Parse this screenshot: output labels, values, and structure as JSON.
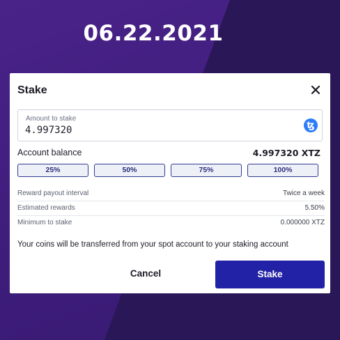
{
  "overlay": {
    "date": "06.22.2021"
  },
  "modal": {
    "title": "Stake",
    "close_icon": "close-icon",
    "amount": {
      "label": "Amount to stake",
      "value": "4.997320",
      "coin_icon": "tezos-icon",
      "coin_glyph": "ꜩ"
    },
    "balance": {
      "label": "Account balance",
      "value": "4.997320  XTZ"
    },
    "percent_buttons": [
      "25%",
      "50%",
      "75%",
      "100%"
    ],
    "info": [
      {
        "label": "Reward payout interval",
        "value": "Twice a week"
      },
      {
        "label": "Estimated rewards",
        "value": "5.50%"
      },
      {
        "label": "Minimum to stake",
        "value": "0.000000 XTZ"
      }
    ],
    "note": "Your coins will be transferred from your spot account to your staking account",
    "cancel_label": "Cancel",
    "stake_label": "Stake"
  },
  "colors": {
    "background_light": "#3d1c7a",
    "background_dark": "#2a1757",
    "primary_button": "#2222a6",
    "coin_icon": "#2c7df7"
  }
}
